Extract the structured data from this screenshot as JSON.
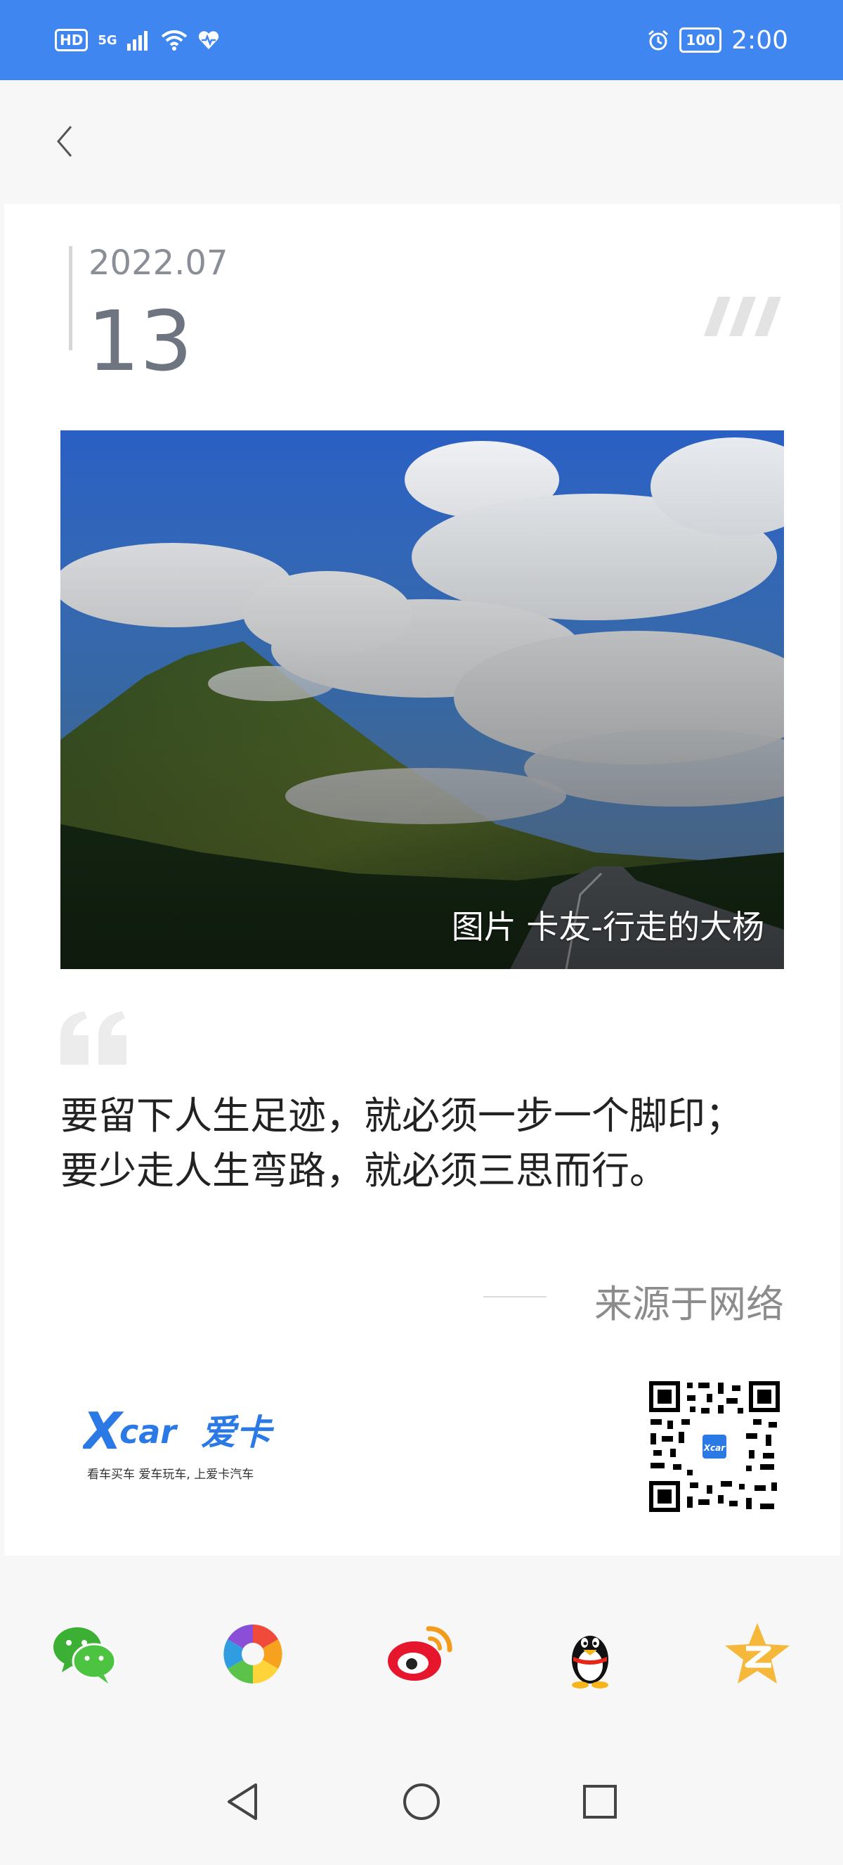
{
  "status_bar": {
    "hd": "HD",
    "network": "5G",
    "battery": "100",
    "time": "2:00"
  },
  "card": {
    "year_month": "2022.07",
    "day": "13",
    "photo_caption": "图片 卡友-行走的大杨",
    "quote": "要留下人生足迹，就必须一步一个脚印；要少走人生弯路，就必须三思而行。",
    "source": "来源于网络",
    "logo_tagline": "看车买车 爱车玩车, 上爱卡汽车",
    "logo_text": "XCAR爱卡"
  },
  "share": {
    "icons": [
      "wechat-icon",
      "moments-icon",
      "weibo-icon",
      "qq-icon",
      "qzone-icon"
    ]
  },
  "colors": {
    "status_bar": "#3f86f0",
    "brand_blue": "#2a79e5"
  }
}
